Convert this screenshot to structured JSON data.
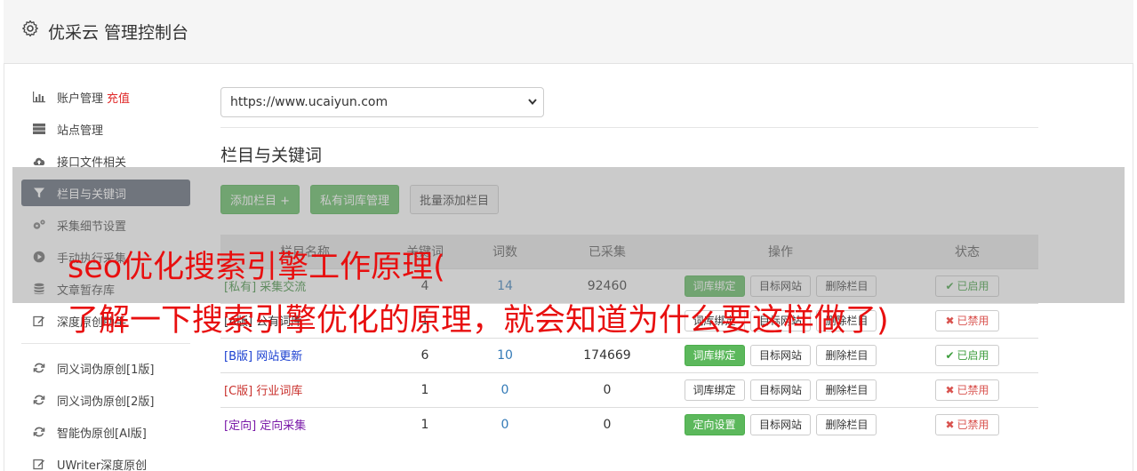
{
  "app": {
    "title": "优采云 管理控制台"
  },
  "sidebar": {
    "items": [
      {
        "label": "账户管理",
        "extra": "充值",
        "icon": "bar-chart-icon"
      },
      {
        "label": "站点管理",
        "icon": "server-icon"
      },
      {
        "label": "接口文件相关",
        "icon": "cloud-upload-icon"
      },
      {
        "label": "栏目与关键词",
        "icon": "filter-icon",
        "active": true
      },
      {
        "label": "采集细节设置",
        "icon": "gears-icon"
      },
      {
        "label": "手动执行采集",
        "icon": "play-circle-icon"
      },
      {
        "label": "文章暂存库",
        "icon": "database-icon"
      },
      {
        "label": "深度原创助手",
        "icon": "edit-icon"
      }
    ],
    "items2": [
      {
        "label": "同义词伪原创[1版]",
        "icon": "refresh-icon"
      },
      {
        "label": "同义词伪原创[2版]",
        "icon": "refresh-icon"
      },
      {
        "label": "智能伪原创[AI版]",
        "icon": "refresh-icon"
      },
      {
        "label": "UWriter深度原创",
        "icon": "edit-icon"
      }
    ]
  },
  "main": {
    "site_select": "https://www.ucaiyun.com",
    "section_title": "栏目与关键词",
    "buttons": {
      "add": "添加栏目 +",
      "private_lib": "私有词库管理",
      "batch_add": "批量添加栏目"
    },
    "columns": [
      "栏目名称",
      "关键词",
      "词数",
      "已采集",
      "操作",
      "状态"
    ],
    "rows": [
      {
        "name": "[私有] 采集交流",
        "name_color": "#3c8d3c",
        "kw": "4",
        "words": "14",
        "collected": "92460",
        "action1": "词库绑定",
        "action2": "目标网站",
        "action3": "删除栏目",
        "status": "已启用",
        "on": true
      },
      {
        "name": "[A版] 公有词库",
        "name_color": "#333",
        "kw": "1",
        "words": "",
        "collected": "",
        "action1": "词库绑定",
        "action2": "目标网站",
        "action3": "删除栏目",
        "status": "已禁用",
        "on": false
      },
      {
        "name": "[B版] 网站更新",
        "name_color": "#1a3fd0",
        "kw": "6",
        "words": "10",
        "collected": "174669",
        "action1": "词库绑定",
        "action2": "目标网站",
        "action3": "删除栏目",
        "status": "已启用",
        "on": true
      },
      {
        "name": "[C版] 行业词库",
        "name_color": "#c9302c",
        "kw": "1",
        "words": "0",
        "collected": "0",
        "action1": "词库绑定",
        "action2": "目标网站",
        "action3": "删除栏目",
        "status": "已禁用",
        "on": false
      },
      {
        "name": "[定向] 定向采集",
        "name_color": "#7a1aa8",
        "kw": "1",
        "words": "0",
        "collected": "0",
        "action1": "定向设置",
        "action2": "目标网站",
        "action3": "删除栏目",
        "status": "已禁用",
        "on": false
      }
    ]
  },
  "overlay": {
    "line1": "seo优化搜索引擎工作原理(",
    "line2": "了解一下搜索引擎优化的原理，就会知道为什么要这样做了)"
  }
}
